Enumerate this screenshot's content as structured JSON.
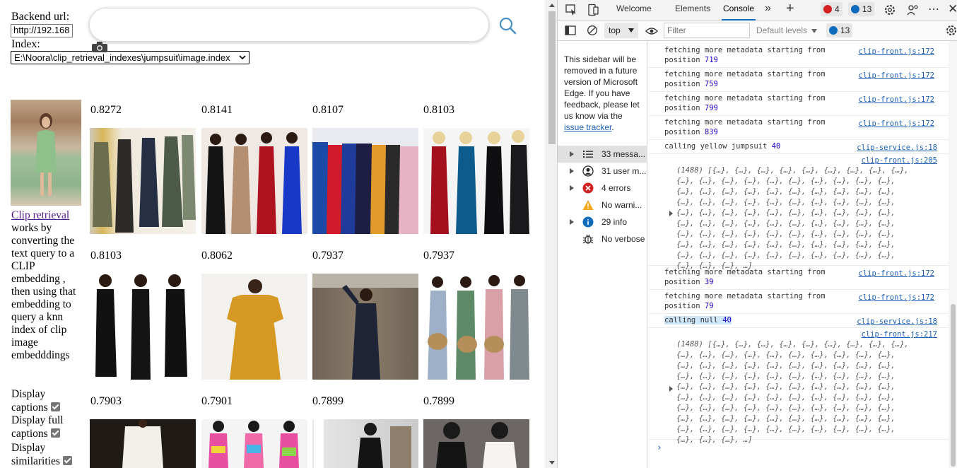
{
  "app": {
    "backend_label": "Backend url:",
    "backend_value": "http://192.168",
    "index_label": "Index:",
    "index_value": "E:\\Noora\\clip_retrieval_indexes\\jumpsuit\\image.index",
    "search_value": "",
    "description_link": "Clip retrieval",
    "description_text": "works by converting the text query to a CLIP embedding , then using that embedding to query a knn index of clip image embedddings",
    "options": [
      {
        "label": "Display captions",
        "checked": true
      },
      {
        "label": "Display full captions",
        "checked": true
      },
      {
        "label": "Display similarities",
        "checked": true
      }
    ],
    "results": [
      {
        "score": "0.8272"
      },
      {
        "score": "0.8141"
      },
      {
        "score": "0.8107"
      },
      {
        "score": "0.8103"
      },
      {
        "score": "0.8103"
      },
      {
        "score": "0.8062"
      },
      {
        "score": "0.7937"
      },
      {
        "score": "0.7937"
      },
      {
        "score": "0.7903"
      },
      {
        "score": "0.7901"
      },
      {
        "score": "0.7899"
      },
      {
        "score": "0.7899"
      }
    ]
  },
  "devtools": {
    "tabs": [
      "Welcome",
      "Elements",
      "Console"
    ],
    "active_tab": "Console",
    "error_count": "4",
    "message_count": "13",
    "context": "top",
    "filter_placeholder": "Filter",
    "levels": "Default levels",
    "toolbar_message_count": "13",
    "sidebar_note": "This sidebar will be removed in a future version of Microsoft Edge. If you have feedback, please let us know via the",
    "sidebar_link": "issue tracker",
    "sidebar_items": [
      {
        "label": "33 messa...",
        "icon": "list-icon"
      },
      {
        "label": "31 user m...",
        "icon": "user-icon"
      },
      {
        "label": "4 errors",
        "icon": "error-icon"
      },
      {
        "label": "No warni...",
        "icon": "warning-icon"
      },
      {
        "label": "29 info",
        "icon": "info-icon"
      },
      {
        "label": "No verbose",
        "icon": "bug-icon"
      }
    ],
    "console": {
      "fetch_text": "fetching more metadata starting from",
      "position_word": "position",
      "fetch_rows": [
        {
          "position": "719",
          "source": "clip-front.js:172"
        },
        {
          "position": "759",
          "source": "clip-front.js:172"
        },
        {
          "position": "799",
          "source": "clip-front.js:172"
        },
        {
          "position": "839",
          "source": "clip-front.js:172"
        }
      ],
      "call1_text": "calling yellow jumpsuit",
      "call1_num": "40",
      "call1_src": "clip-service.js:18",
      "array1_src": "clip-front.js:205",
      "array_head": "(1488) [{…}, {…}, {…}, {…}, {…}, {…}, {…}, {…}, {…},",
      "array_line": "{…}, {…}, {…}, {…}, {…}, {…}, {…}, {…}, {…}, {…},",
      "array_tail": "{…}, {…}, {…}, …]",
      "fetch_rows2": [
        {
          "position": "39",
          "source": "clip-front.js:172"
        },
        {
          "position": "79",
          "source": "clip-front.js:172"
        }
      ],
      "call2_text": "calling null",
      "call2_num": "40",
      "call2_src": "clip-service.js:18",
      "array2_src": "clip-front.js:217",
      "prompt": "›"
    }
  }
}
